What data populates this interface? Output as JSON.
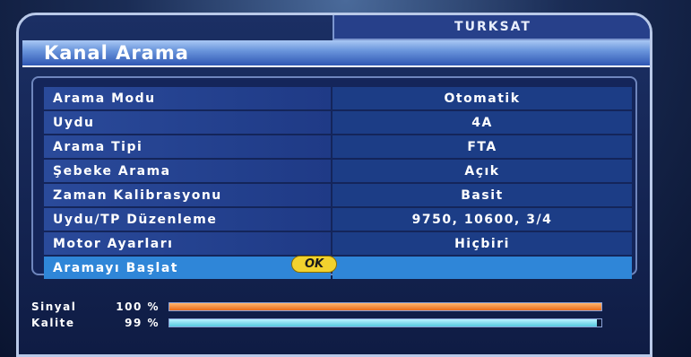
{
  "satellite_tab": "TURKSAT",
  "title": "Kanal Arama",
  "menu": [
    {
      "label": "Arama Modu",
      "value": "Otomatik"
    },
    {
      "label": "Uydu",
      "value": "4A"
    },
    {
      "label": "Arama Tipi",
      "value": "FTA"
    },
    {
      "label": "Şebeke Arama",
      "value": "Açık"
    },
    {
      "label": "Zaman Kalibrasyonu",
      "value": "Basit"
    },
    {
      "label": "Uydu/TP Düzenleme",
      "value": "9750, 10600, 3/4"
    },
    {
      "label": "Motor Ayarları",
      "value": "Hiçbiri"
    }
  ],
  "start_scan": {
    "label": "Aramayı Başlat",
    "button": "OK"
  },
  "signal": {
    "label": "Sinyal",
    "percent_text": "100 %",
    "level": 1.0
  },
  "quality": {
    "label": "Kalite",
    "percent_text": "99 %",
    "level": 0.99
  },
  "colors": {
    "highlight": "#2f86d8",
    "ok_button": "#f2d22e",
    "signal_bar": "#e86c1a",
    "quality_bar": "#55c9df"
  }
}
